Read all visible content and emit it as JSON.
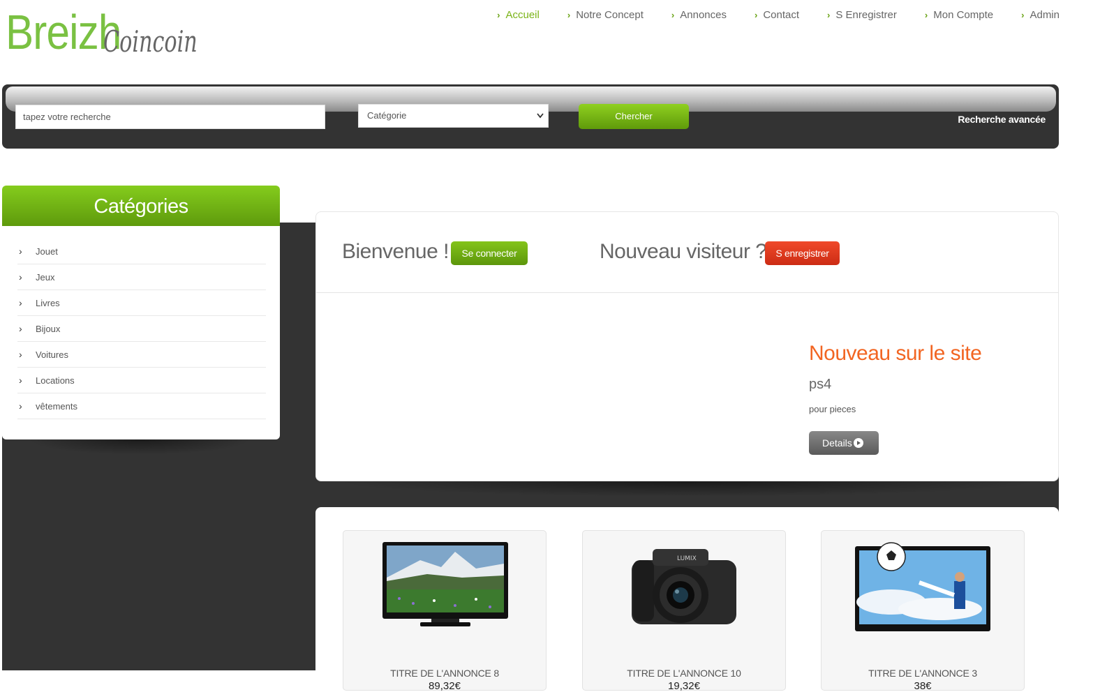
{
  "brand": {
    "part1": "Breizh",
    "part2": "Coincoin"
  },
  "nav": [
    {
      "label": "Accueil",
      "active": true
    },
    {
      "label": "Notre Concept"
    },
    {
      "label": "Annonces"
    },
    {
      "label": "Contact"
    },
    {
      "label": "S Enregistrer"
    },
    {
      "label": "Mon Compte"
    },
    {
      "label": "Admin"
    }
  ],
  "search": {
    "placeholder": "tapez votre recherche",
    "category_selected": "Catégorie",
    "button": "Chercher",
    "advanced": "Recherche avancée"
  },
  "sidebar": {
    "title": "Catégories",
    "items": [
      "Jouet",
      "Jeux",
      "Livres",
      "Bijoux",
      "Voitures",
      "Locations",
      "vêtements"
    ]
  },
  "welcome": {
    "greeting": "Bienvenue !",
    "login_button": "Se connecter",
    "new_visitor": "Nouveau visiteur ?",
    "register_button": "S enregistrer"
  },
  "featured": {
    "heading": "Nouveau sur le site",
    "name": "ps4",
    "description": "pour pieces",
    "details_button": "Details"
  },
  "listings": [
    {
      "title": "TITRE DE L'ANNONCE 8",
      "price": "89,32€",
      "image": "tv-landscape"
    },
    {
      "title": "TITRE DE L'ANNONCE 10",
      "price": "19,32€",
      "image": "camera"
    },
    {
      "title": "TITRE DE L'ANNONCE 3",
      "price": "38€",
      "image": "tv-football"
    }
  ],
  "colors": {
    "accent_green": "#6aa316",
    "orange": "#f26522",
    "red": "#d9351a",
    "dark": "#333333"
  }
}
